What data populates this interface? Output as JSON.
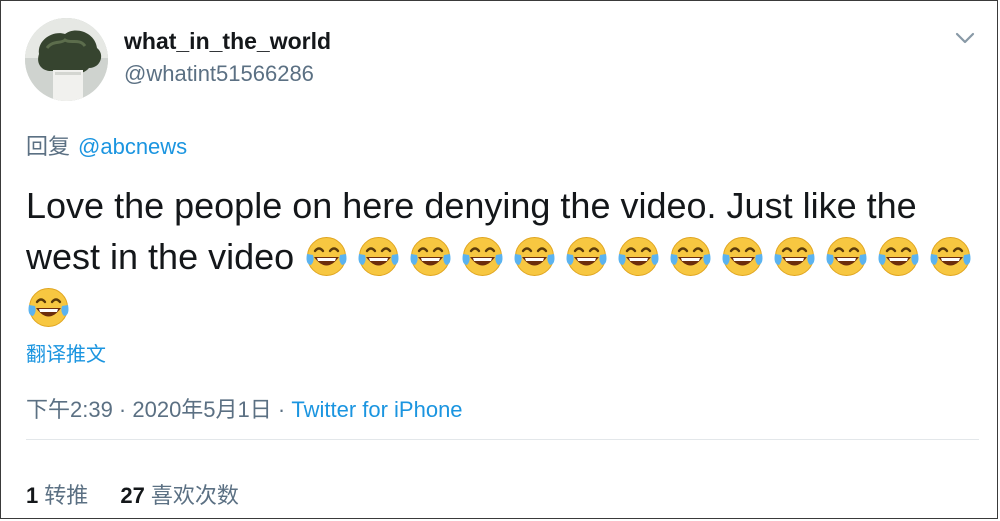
{
  "user": {
    "display_name": "what_in_the_world",
    "handle": "@whatint51566286",
    "avatar_icon": "avatar-plant-photo"
  },
  "menu": {
    "icon": "chevron-down-icon"
  },
  "reply": {
    "prefix": "回复",
    "to_handle": "@abcnews"
  },
  "tweet": {
    "text": "Love the people on here denying the video. Just like the west in the video",
    "emoji_icon": "face-with-tears-of-joy-icon",
    "emoji_count": 14
  },
  "translate_label": "翻译推文",
  "meta": {
    "time": "下午2:39 · 2020年5月1日",
    "separator": " · ",
    "source": "Twitter for iPhone"
  },
  "stats": {
    "retweets_count": "1",
    "retweets_label": "转推",
    "likes_count": "27",
    "likes_label": "喜欢次数"
  },
  "colors": {
    "link": "#1b95e0",
    "secondary_text": "#5b7083",
    "primary_text": "#14171a"
  }
}
